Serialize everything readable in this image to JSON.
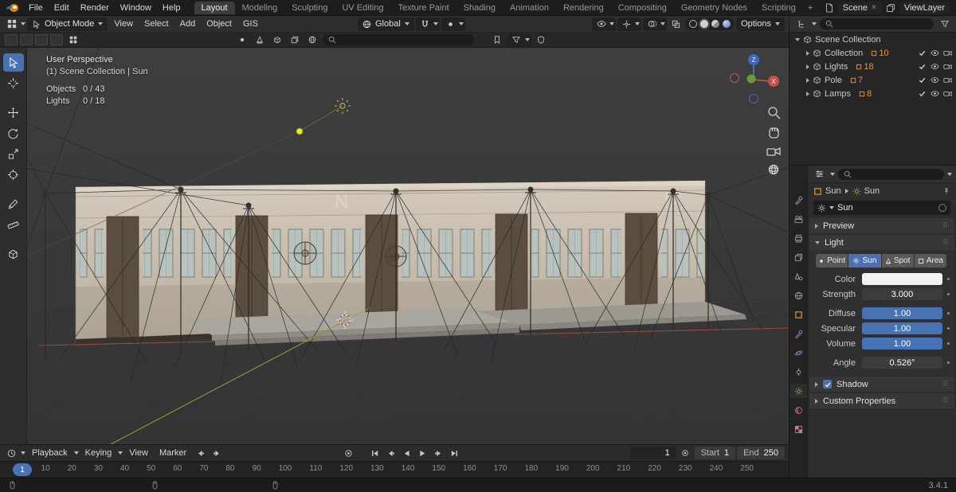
{
  "topbar": {
    "menus": [
      "File",
      "Edit",
      "Render",
      "Window",
      "Help"
    ],
    "tabs": [
      "Layout",
      "Modeling",
      "Sculpting",
      "UV Editing",
      "Texture Paint",
      "Shading",
      "Animation",
      "Rendering",
      "Compositing",
      "Geometry Nodes",
      "Scripting"
    ],
    "add_workspace": "+",
    "scene_label": "Scene",
    "viewlayer_label": "ViewLayer"
  },
  "vheader": {
    "mode": "Object Mode",
    "menus": [
      "View",
      "Select",
      "Add",
      "Object",
      "GIS"
    ],
    "orientation": "Global",
    "options_label": "Options"
  },
  "viewport": {
    "overlay_line1": "User Perspective",
    "overlay_line2": "(1) Scene Collection | Sun",
    "objects_label": "Objects",
    "objects_value": "0 / 43",
    "lights_label": "Lights",
    "lights_value": "0 / 18",
    "axis_x": "X",
    "axis_z": "Z",
    "building_mark": "N"
  },
  "outliner": {
    "root_label": "Scene Collection",
    "items": [
      {
        "label": "Collection",
        "badge": "10"
      },
      {
        "label": "Lights",
        "badge": "18"
      },
      {
        "label": "Pole",
        "badge": "7"
      },
      {
        "label": "Lamps",
        "badge": "8"
      }
    ]
  },
  "properties": {
    "breadcrumb_object": "Sun",
    "breadcrumb_data": "Sun",
    "name_value": "Sun",
    "panels": {
      "preview": "Preview",
      "light": "Light",
      "shadow": "Shadow",
      "custom": "Custom Properties"
    },
    "light_types": [
      "Point",
      "Sun",
      "Spot",
      "Area"
    ],
    "active_light_type": "Sun",
    "fields": {
      "color_label": "Color",
      "strength_label": "Strength",
      "strength_value": "3.000",
      "diffuse_label": "Diffuse",
      "diffuse_value": "1.00",
      "specular_label": "Specular",
      "specular_value": "1.00",
      "volume_label": "Volume",
      "volume_value": "1.00",
      "angle_label": "Angle",
      "angle_value": "0.526°"
    }
  },
  "timeline": {
    "menus": [
      "Playback",
      "Keying",
      "View",
      "Marker"
    ],
    "current_frame": "1",
    "start_label": "Start",
    "start_value": "1",
    "end_label": "End",
    "end_value": "250",
    "marker_frame": "1",
    "ticks": [
      "1",
      "10",
      "20",
      "30",
      "40",
      "50",
      "60",
      "70",
      "80",
      "90",
      "100",
      "110",
      "120",
      "130",
      "140",
      "150",
      "160",
      "170",
      "180",
      "190",
      "200",
      "210",
      "220",
      "230",
      "240",
      "250"
    ]
  },
  "statusbar": {
    "version": "3.4.1"
  },
  "colors": {
    "accent": "#4772b3",
    "badge_orange": "#e8933a",
    "axis_red": "#a34c46",
    "axis_green": "#8a9a33"
  }
}
